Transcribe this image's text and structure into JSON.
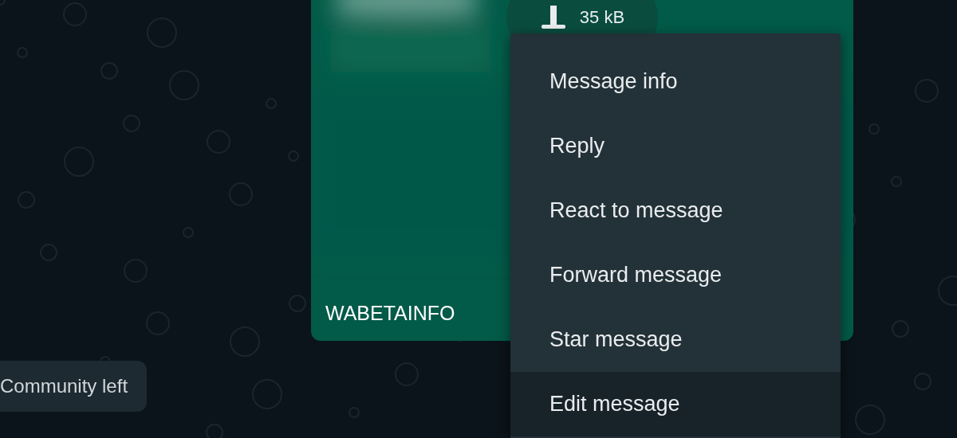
{
  "message": {
    "download": {
      "size": "35 kB"
    },
    "caption": "WABETAINFO"
  },
  "context_menu": {
    "items": [
      {
        "label": "Message info",
        "selected": false
      },
      {
        "label": "Reply",
        "selected": false
      },
      {
        "label": "React to message",
        "selected": false
      },
      {
        "label": "Forward message",
        "selected": false
      },
      {
        "label": "Star message",
        "selected": false
      },
      {
        "label": "Edit message",
        "selected": true
      }
    ]
  },
  "system_notice": "Community left"
}
